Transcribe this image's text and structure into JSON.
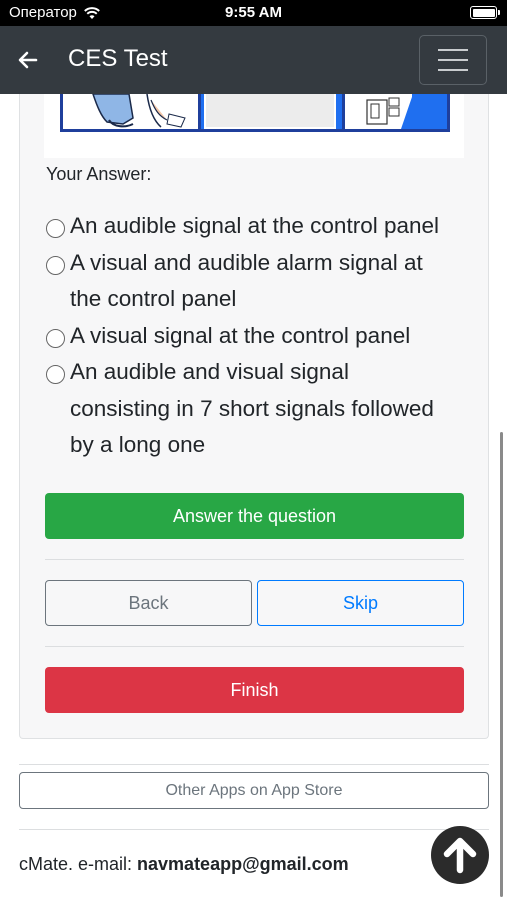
{
  "status_bar": {
    "carrier": "Оператор",
    "time": "9:55 AM"
  },
  "navbar": {
    "title": "CES Test",
    "back_icon": "arrow-left-icon",
    "menu_icon": "hamburger-menu-icon"
  },
  "question": {
    "answer_label": "Your Answer:",
    "options": [
      {
        "line1": "An audible signal at the control panel",
        "line2": "",
        "line3": ""
      },
      {
        "line1": "A visual and audible alarm signal at",
        "line2": "the control panel",
        "line3": ""
      },
      {
        "line1": "A visual signal at the control panel",
        "line2": "",
        "line3": ""
      },
      {
        "line1": "An audible and visual signal",
        "line2": "consisting in 7 short signals followed",
        "line3": "by a long one"
      }
    ]
  },
  "buttons": {
    "answer": "Answer the question",
    "back": "Back",
    "skip": "Skip",
    "finish": "Finish"
  },
  "footer": {
    "other_apps": "Other Apps on App Store",
    "contact_prefix": "cMate. e-mail: ",
    "email": "navmateapp@gmail.com",
    "up_icon": "arrow-up-circle-icon"
  },
  "colors": {
    "navbar": "#343a40",
    "answer": "#28a745",
    "finish": "#dc3545",
    "skip": "#007bff",
    "illustration_frame": "#1f6ff0"
  }
}
